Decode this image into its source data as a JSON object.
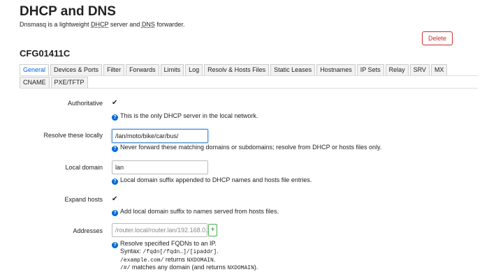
{
  "header": {
    "title": "DHCP and DNS",
    "desc_part1": "Dnsmasq is a lightweight ",
    "desc_dhcp": "DHCP",
    "desc_part2": " server and ",
    "desc_dns": "DNS",
    "desc_part3": " forwarder."
  },
  "delete_label": "Delete",
  "section_title": "CFG01411C",
  "tabs_row1": [
    "General",
    "Devices & Ports",
    "Filter",
    "Forwards",
    "Limits",
    "Log",
    "Resolv & Hosts Files",
    "Static Leases",
    "Hostnames",
    "IP Sets",
    "Relay",
    "SRV",
    "MX"
  ],
  "tabs_row2": [
    "CNAME",
    "PXE/TFTP"
  ],
  "active_tab": "General",
  "form": {
    "authoritative": {
      "label": "Authoritative",
      "checked_glyph": "✔",
      "help": "This is the only DHCP server in the local network."
    },
    "resolve_locally": {
      "label": "Resolve these locally",
      "value": "/lan/moto/bike/car/bus/",
      "help": "Never forward these matching domains or subdomains; resolve from DHCP or hosts files only."
    },
    "local_domain": {
      "label": "Local domain",
      "value": "lan",
      "help": "Local domain suffix appended to DHCP names and hosts file entries."
    },
    "expand_hosts": {
      "label": "Expand hosts",
      "checked_glyph": "✔",
      "help": "Add local domain suffix to names served from hosts files."
    },
    "addresses": {
      "label": "Addresses",
      "placeholder": "/router.local/router.lan/192.168.0.1",
      "add_label": "+",
      "help": "Resolve specified FQDNs to an IP.",
      "syntax_label": "Syntax: ",
      "syntax_code": "/fqdn[/fqdn…]/[ipaddr]",
      "syntax_end": ".",
      "ex1_code": "/example.com/",
      "ex1_text": " returns ",
      "ex1_code2": "NXDOMAIN",
      "ex1_end": ".",
      "ex2_code": "/#/",
      "ex2_text": " matches any domain (and returns ",
      "ex2_code2": "NXDOMAIN",
      "ex2_end": ")."
    }
  },
  "help_icon_glyph": "?"
}
